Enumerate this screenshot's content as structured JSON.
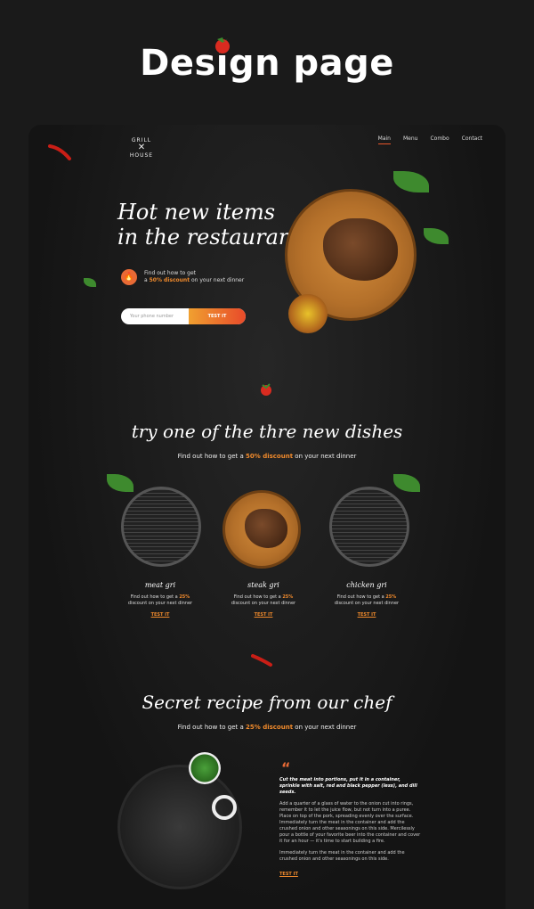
{
  "poster": {
    "title": "Design page"
  },
  "logo": {
    "line1": "GRILL",
    "line2": "HOUSE"
  },
  "nav": {
    "items": [
      "Main",
      "Menu",
      "Combo",
      "Contact"
    ],
    "active": "Main"
  },
  "hero": {
    "title_line1": "Hot new items",
    "title_line2": "in the restaurant",
    "offer_line1": "Find out how to get",
    "offer_pre": "a",
    "offer_highlight": "50% discount",
    "offer_post": "on your next dinner",
    "phone_placeholder": "Your phone number",
    "button": "TEST IT"
  },
  "dishes_section": {
    "title": "try one of the thre new dishes",
    "subtitle_pre": "Find out how to get a",
    "subtitle_highlight": "50% discount",
    "subtitle_post": "on your next dinner",
    "items": [
      {
        "name": "meat gri",
        "desc_pre": "Find out how to get a",
        "desc_highlight": "25%",
        "desc_post": "discount on your next dinner",
        "cta": "TEST IT"
      },
      {
        "name": "steak gri",
        "desc_pre": "Find out how to get a",
        "desc_highlight": "25%",
        "desc_post": "discount on your next dinner",
        "cta": "TEST IT"
      },
      {
        "name": "chicken gri",
        "desc_pre": "Find out how to get a",
        "desc_highlight": "25%",
        "desc_post": "discount on your next dinner",
        "cta": "TEST IT"
      }
    ]
  },
  "recipe_section": {
    "title": "Secret recipe from our chef",
    "subtitle_pre": "Find out how to get a",
    "subtitle_highlight": "25% discount",
    "subtitle_post": "on your next dinner",
    "quote_mark": "“",
    "lead": "Cut the meat into portions, put it in a container, sprinkle with salt, red and black pepper (less), and dill seeds.",
    "para1": "Add a quarter of a glass of water to the onion cut into rings, remember it to let the juice flow, but not turn into a puree. Place on top of the pork, spreading evenly over the surface. Immediately turn the meat in the container and add the crushed onion and other seasonings on this side. Mercilessly pour a bottle of your favorite beer into the container and cover it for an hour — it's time to start building a fire.",
    "para2": "Immediately turn the meat in the container and add the crushed onion and other seasonings on this side.",
    "cta": "TEST IT"
  },
  "colors": {
    "accent": "#f08a2c",
    "button_start": "#f0a030",
    "button_end": "#e84a2a",
    "background": "#1a1a1a"
  }
}
